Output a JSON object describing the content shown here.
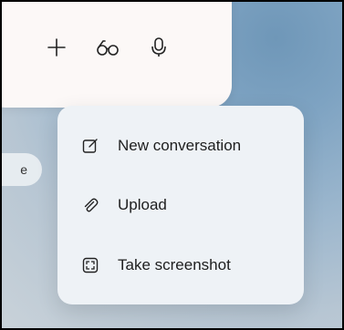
{
  "background_pill": {
    "text": "e"
  },
  "composer": {
    "actions": [
      {
        "icon": "plus-icon"
      },
      {
        "icon": "glasses-icon"
      },
      {
        "icon": "microphone-icon"
      }
    ]
  },
  "menu": {
    "items": [
      {
        "label": "New conversation",
        "icon": "new-conversation-icon"
      },
      {
        "label": "Upload",
        "icon": "paperclip-icon"
      },
      {
        "label": "Take screenshot",
        "icon": "screenshot-icon"
      }
    ]
  },
  "colors": {
    "menu_bg": "#eef2f6",
    "card_bg": "#fcf8f7",
    "text": "#1e1e1e"
  }
}
